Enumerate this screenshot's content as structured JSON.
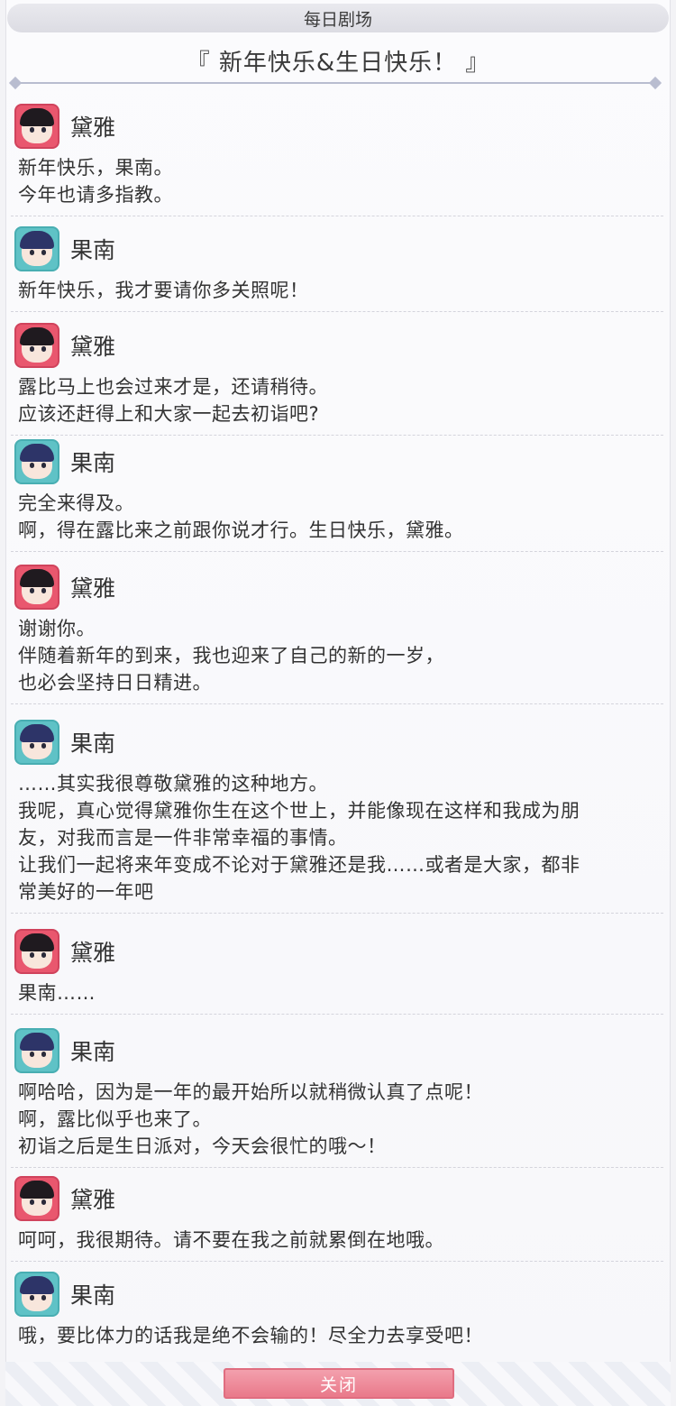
{
  "header": {
    "title": "每日剧场"
  },
  "episode_title": "『 新年快乐&生日快乐！ 』",
  "dialogs": [
    {
      "speaker": "黛雅",
      "avatar": "dia-avatar",
      "lines": [
        "新年快乐，果南。",
        "今年也请多指教。"
      ]
    },
    {
      "speaker": "果南",
      "avatar": "kanan-avatar",
      "lines": [
        "新年快乐，我才要请你多关照呢！"
      ]
    },
    {
      "speaker": "黛雅",
      "avatar": "dia-avatar",
      "lines": [
        "露比马上也会过来才是，还请稍待。",
        "应该还赶得上和大家一起去初诣吧?"
      ]
    },
    {
      "speaker": "果南",
      "avatar": "kanan-avatar",
      "lines": [
        "完全来得及。",
        "啊，得在露比来之前跟你说才行。生日快乐，黛雅。"
      ]
    },
    {
      "speaker": "黛雅",
      "avatar": "dia-avatar",
      "lines": [
        "谢谢你。",
        "伴随着新年的到来，我也迎来了自己的新的一岁，",
        "也必会坚持日日精进。"
      ]
    },
    {
      "speaker": "果南",
      "avatar": "kanan-avatar",
      "lines": [
        "……其实我很尊敬黛雅的这种地方。",
        "我呢，真心觉得黛雅你生在这个世上，并能像现在这样和我成为朋",
        "友，对我而言是一件非常幸福的事情。",
        "让我们一起将来年变成不论对于黛雅还是我……或者是大家，都非",
        "常美好的一年吧"
      ]
    },
    {
      "speaker": "黛雅",
      "avatar": "dia-avatar",
      "lines": [
        "果南……"
      ]
    },
    {
      "speaker": "果南",
      "avatar": "kanan-avatar",
      "lines": [
        "啊哈哈，因为是一年的最开始所以就稍微认真了点呢！",
        "啊，露比似乎也来了。",
        "初诣之后是生日派对，今天会很忙的哦～！"
      ]
    },
    {
      "speaker": "黛雅",
      "avatar": "dia-avatar",
      "lines": [
        "呵呵，我很期待。请不要在我之前就累倒在地哦。"
      ]
    },
    {
      "speaker": "果南",
      "avatar": "kanan-avatar",
      "lines": [
        "哦，要比体力的话我是绝不会输的！尽全力去享受吧！"
      ]
    }
  ],
  "footer": {
    "close_label": "关闭"
  },
  "colors": {
    "dia_accent": "#e9576e",
    "kanan_accent": "#5fc2c6",
    "close_button": "#e9798a"
  }
}
